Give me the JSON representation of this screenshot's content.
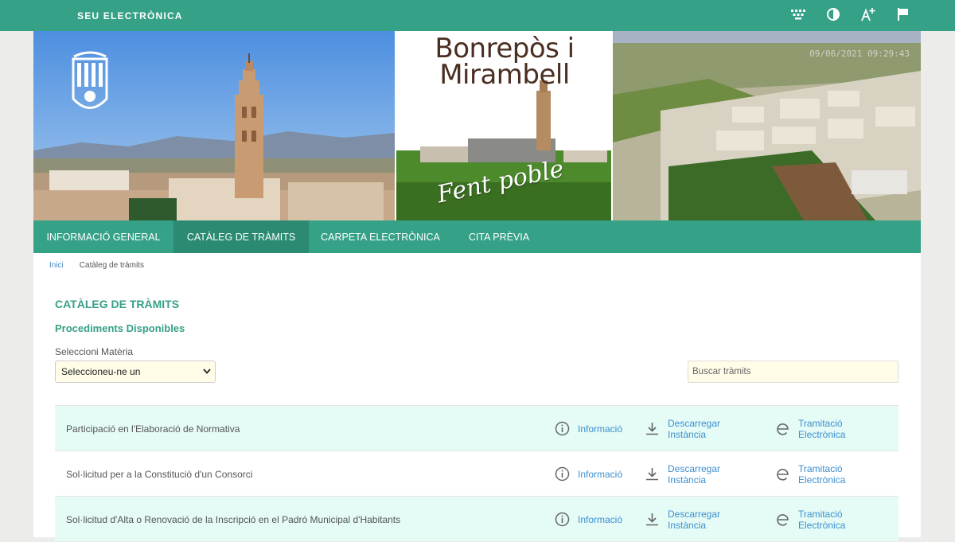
{
  "topbar": {
    "brand": "SEU ELECTRÒNICA",
    "tools": [
      "keyboard-icon",
      "contrast-icon",
      "text-size-increase-icon",
      "flag-icon"
    ]
  },
  "banner": {
    "town_name": "Bonrepòs i Mirambell",
    "slogan": "Fent poble",
    "datetime": "09/06/2021 09:29:43"
  },
  "nav": {
    "items": [
      {
        "label": "Informació General"
      },
      {
        "label": "Catàleg de tràmits"
      },
      {
        "label": "Carpeta Electrònica"
      },
      {
        "label": "Cita Prèvia"
      }
    ]
  },
  "breadcrumb": {
    "home": "Inici",
    "current": "Catàleg de tràmits"
  },
  "main": {
    "title": "CATÀLEG DE TRÀMITS",
    "subtitle": "Procediments Disponibles",
    "select_label": "Seleccioni Matèria",
    "select_value": "Seleccioneu-ne un",
    "search_placeholder": "Buscar tràmits"
  },
  "actions": {
    "info": "Informació",
    "download_line1": "Descarregar",
    "download_line2": "Instància",
    "etram_line1": "Tramitació",
    "etram_line2": "Electrònica"
  },
  "procedures": [
    {
      "title": "Participació en l'Elaboració de Normativa"
    },
    {
      "title": "Sol·licitud per a la Constitució d'un Consorci"
    },
    {
      "title": "Sol·licitud d'Alta o Renovació de la Inscripció en el Padró Municipal d'Habitants"
    }
  ],
  "colors": {
    "primary": "#35a187",
    "nav_active": "#2a8a72",
    "link": "#3d8fd0",
    "row_alt": "#e4fbf6",
    "input_bg": "#fffde8"
  }
}
